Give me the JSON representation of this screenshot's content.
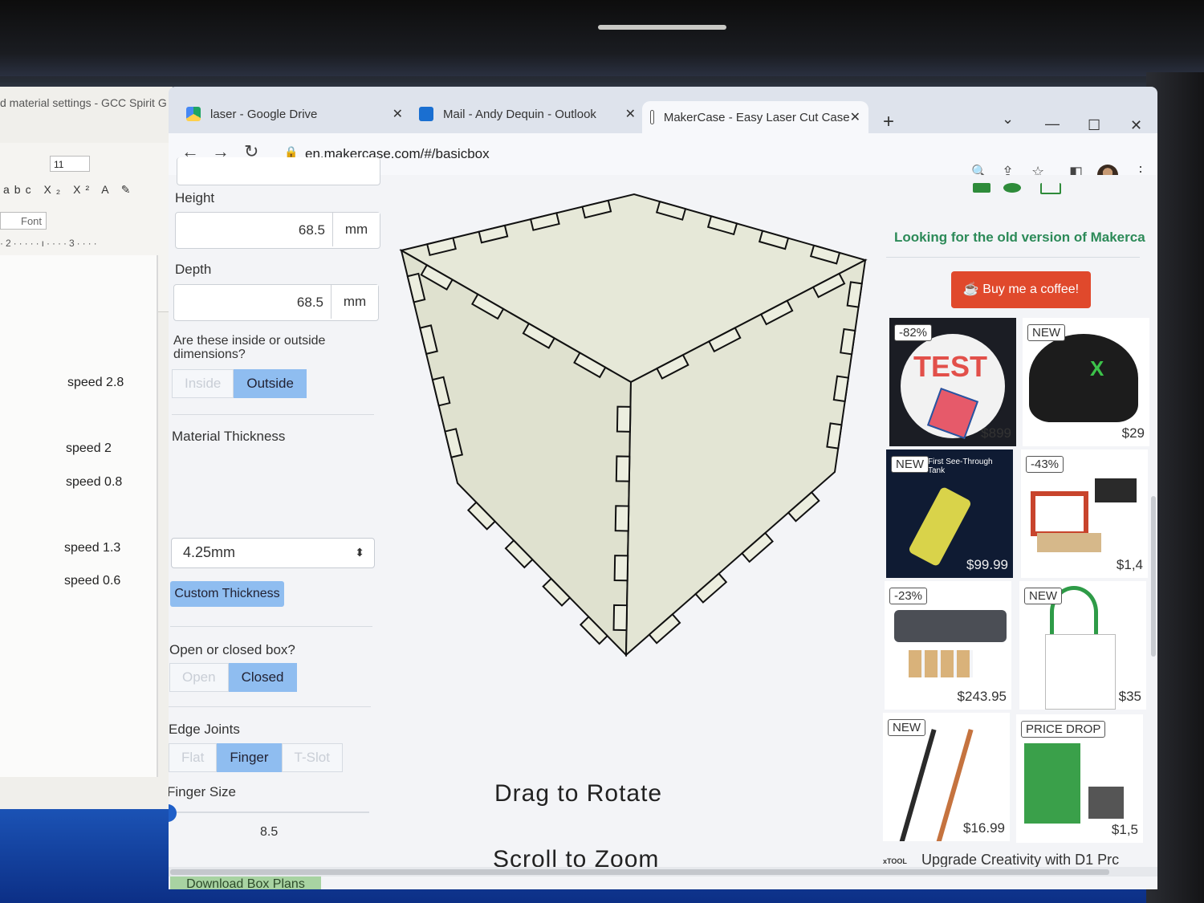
{
  "word": {
    "title": "d material settings - GCC Spirit G",
    "font_size": "11",
    "tools": "abc X₂ X² A ✎",
    "font_label": "Font",
    "ruler": "·2·····ı····3····",
    "lines": [
      "speed 2.8",
      "speed 2",
      "speed 0.8",
      "speed 1.3",
      "speed 0.6"
    ]
  },
  "browser": {
    "tabs": [
      {
        "label": "laser - Google Drive",
        "icon": "google-drive-icon",
        "close": "✕"
      },
      {
        "label": "Mail - Andy Dequin - Outlook",
        "icon": "outlook-icon",
        "close": "✕"
      },
      {
        "label": "MakerCase - Easy Laser Cut Case",
        "icon": "page-icon",
        "close": "✕"
      }
    ],
    "new_tab": "+",
    "window_controls": {
      "menu": "⌄",
      "minimize": "—",
      "maximize": "☐",
      "close": "✕"
    },
    "nav": {
      "back": "←",
      "forward": "→",
      "reload": "↻"
    },
    "url": "en.makercase.com/#/basicbox",
    "toolbar_icons": {
      "zoom": "🔍",
      "share": "⇪",
      "bookmark": "☆",
      "sidepanel": "◧",
      "menu": "⋮"
    }
  },
  "form": {
    "height": {
      "label": "Height",
      "value": "68.5",
      "unit": "mm"
    },
    "depth": {
      "label": "Depth",
      "value": "68.5",
      "unit": "mm"
    },
    "dimensions_question": "Are these inside or outside dimensions?",
    "dimensions_options": {
      "inside": "Inside",
      "outside": "Outside"
    },
    "thickness": {
      "label": "Material Thickness",
      "value": "4.25mm",
      "custom_button": "Custom Thickness"
    },
    "open_closed": {
      "label": "Open or closed box?",
      "open": "Open",
      "closed": "Closed"
    },
    "edge_joints": {
      "label": "Edge Joints",
      "flat": "Flat",
      "finger": "Finger",
      "tslot": "T-Slot"
    },
    "finger_size": {
      "label": "Finger Size",
      "value": "8.5"
    },
    "download_button": "Download Box Plans"
  },
  "viewer": {
    "rotate_hint": "Drag to Rotate",
    "zoom_hint": "Scroll to Zoom"
  },
  "sidebar": {
    "old_version_link": "Looking for the old version of Makerca",
    "coffee_button": "Buy me a coffee!",
    "products": [
      {
        "badge": "-82%",
        "price": "$899",
        "overlay": "TEST"
      },
      {
        "badge": "NEW",
        "price": "$29"
      },
      {
        "badge": "NEW",
        "price": "$99.99",
        "caption": "First See-Through Tank"
      },
      {
        "badge": "-43%",
        "price": "$1,4"
      },
      {
        "badge": "-23%",
        "price": "$243.95"
      },
      {
        "badge": "NEW",
        "price": "$35"
      },
      {
        "badge": "NEW",
        "price": "$16.99"
      },
      {
        "badge": "PRICE DROP",
        "price": "$1,5"
      }
    ],
    "footer_brand": "xTOOL",
    "footer_text": "Upgrade Creativity with D1 Prc"
  },
  "colors": {
    "accent_blue": "#8fbdf0",
    "download_green": "#a8d3a2",
    "coffee_red": "#e0492c",
    "link_green": "#2c8a58",
    "box_face": "#e6e8d8"
  }
}
